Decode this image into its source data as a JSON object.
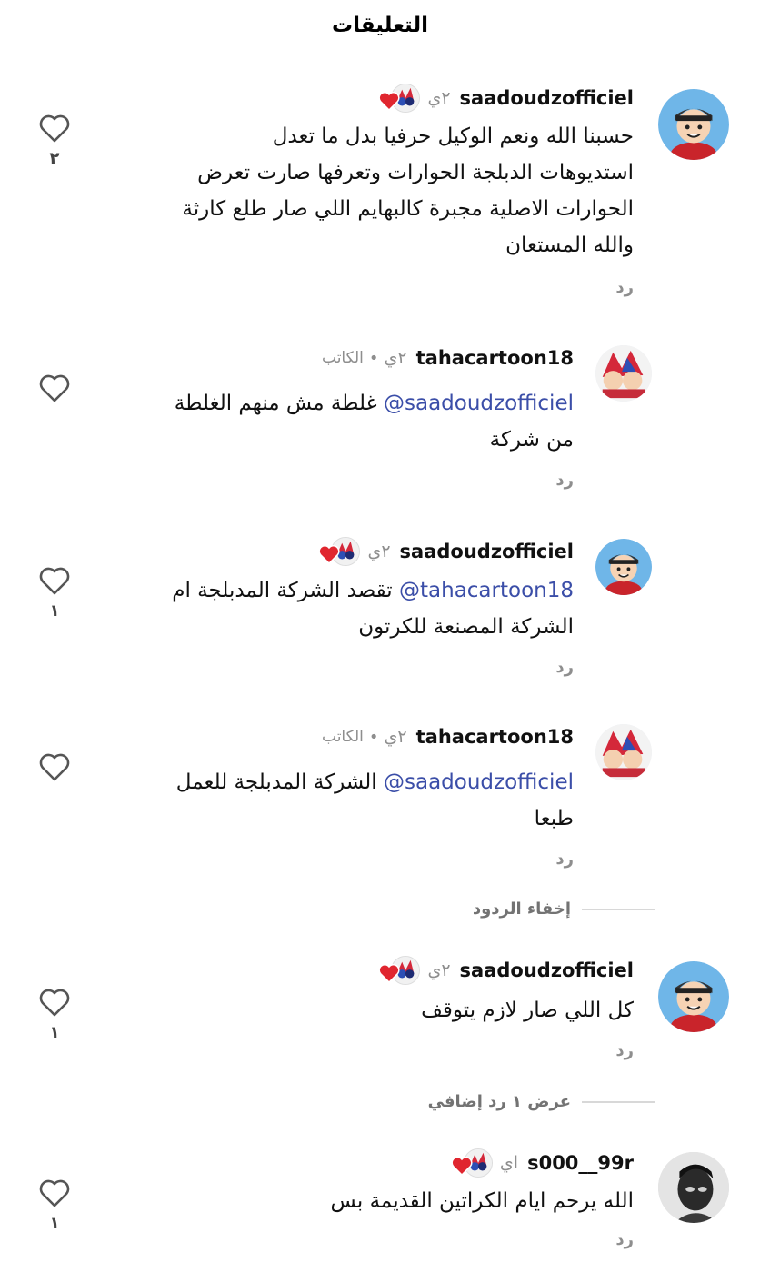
{
  "header": {
    "title": "التعليقات"
  },
  "actions": {
    "reply": "رد",
    "hide_replies": "إخفاء الردود",
    "view_more": "عرض ١ رد إضافي"
  },
  "comments": [
    {
      "username": "saadoudzofficiel",
      "time": "٢ي",
      "liked_by_author": true,
      "is_author": false,
      "author_tag": "",
      "mention": "",
      "lines": [
        "حسبنا الله ونعم الوكيل حرفيا بدل ما تعدل",
        "استديوهات الدبلجة الحوارات وتعرفها صارت تعرض",
        "الحوارات الاصلية مجبرة كالبهايم اللي صار طلع كارثة",
        "والله المستعان"
      ],
      "likes": "٢",
      "avatar": "cartoon-boy-cap"
    },
    {
      "username": "tahacartoon18",
      "time": "٢ي",
      "is_author": true,
      "author_tag": "الكاتب",
      "liked_by_author": false,
      "mention": "@saadoudzofficiel",
      "lines": [
        "غلطة مش منهم الغلطة",
        "من شركة"
      ],
      "likes": "",
      "avatar": "anime-group"
    },
    {
      "username": "saadoudzofficiel",
      "time": "٢ي",
      "liked_by_author": true,
      "is_author": false,
      "author_tag": "",
      "mention": "@tahacartoon18",
      "lines": [
        "تقصد الشركة المدبلجة ام",
        "الشركة المصنعة للكرتون"
      ],
      "likes": "١",
      "avatar": "cartoon-boy-cap"
    },
    {
      "username": "tahacartoon18",
      "time": "٢ي",
      "is_author": true,
      "author_tag": "الكاتب",
      "liked_by_author": false,
      "mention": "@saadoudzofficiel",
      "lines": [
        "الشركة المدبلجة للعمل",
        "طبعا"
      ],
      "likes": "",
      "avatar": "anime-group"
    },
    {
      "username": "saadoudzofficiel",
      "time": "٢ي",
      "liked_by_author": true,
      "is_author": false,
      "author_tag": "",
      "mention": "",
      "lines": [
        "كل اللي صار لازم يتوقف"
      ],
      "likes": "١",
      "avatar": "cartoon-boy-cap"
    },
    {
      "username": "s000__99r",
      "time": "اي",
      "liked_by_author": true,
      "is_author": false,
      "author_tag": "",
      "mention": "",
      "lines": [
        "الله يرحم ايام الكراتين القديمة بس"
      ],
      "likes": "١",
      "avatar": "person-photo"
    }
  ],
  "colors": {
    "mention": "#3b4ea8",
    "heart_red": "#e0262f",
    "muted": "#8e8e8e"
  }
}
